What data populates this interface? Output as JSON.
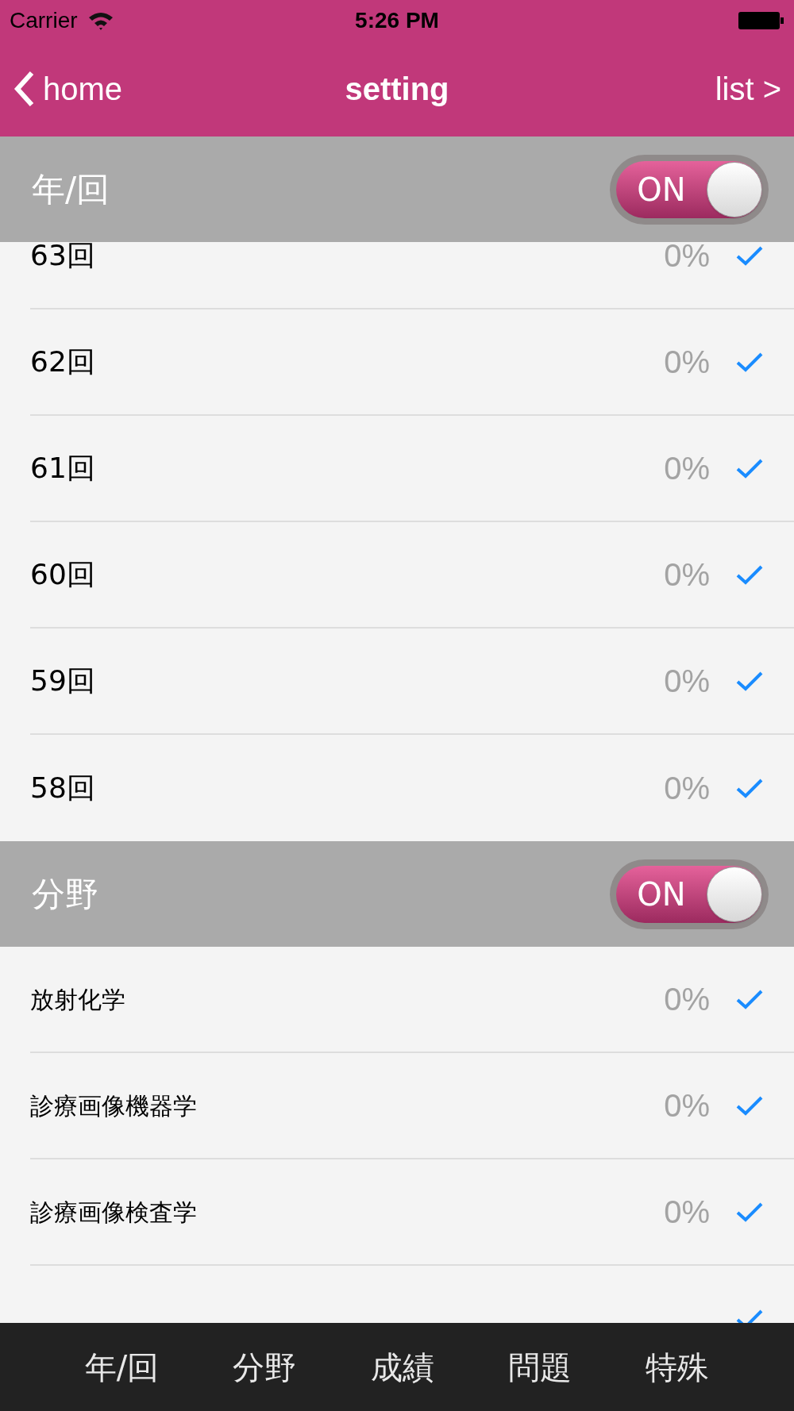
{
  "status_bar": {
    "carrier": "Carrier",
    "time": "5:26 PM"
  },
  "nav": {
    "back": "home",
    "title": "setting",
    "forward": "list >"
  },
  "sections": [
    {
      "kind": "year",
      "title": "年/回",
      "toggle": {
        "on": true,
        "label": "ON"
      },
      "rows": [
        {
          "label": "63回",
          "percent": "0%",
          "checked": true
        },
        {
          "label": "62回",
          "percent": "0%",
          "checked": true
        },
        {
          "label": "61回",
          "percent": "0%",
          "checked": true
        },
        {
          "label": "60回",
          "percent": "0%",
          "checked": true
        },
        {
          "label": "59回",
          "percent": "0%",
          "checked": true
        },
        {
          "label": "58回",
          "percent": "0%",
          "checked": true
        }
      ]
    },
    {
      "kind": "field",
      "title": "分野",
      "toggle": {
        "on": true,
        "label": "ON"
      },
      "rows": [
        {
          "label": "放射化学",
          "percent": "0%",
          "checked": true
        },
        {
          "label": "診療画像機器学",
          "percent": "0%",
          "checked": true
        },
        {
          "label": "診療画像検査学",
          "percent": "0%",
          "checked": true
        },
        {
          "checked": true
        }
      ]
    }
  ],
  "tabs": [
    "年/回",
    "分野",
    "成績",
    "問題",
    "特殊"
  ]
}
